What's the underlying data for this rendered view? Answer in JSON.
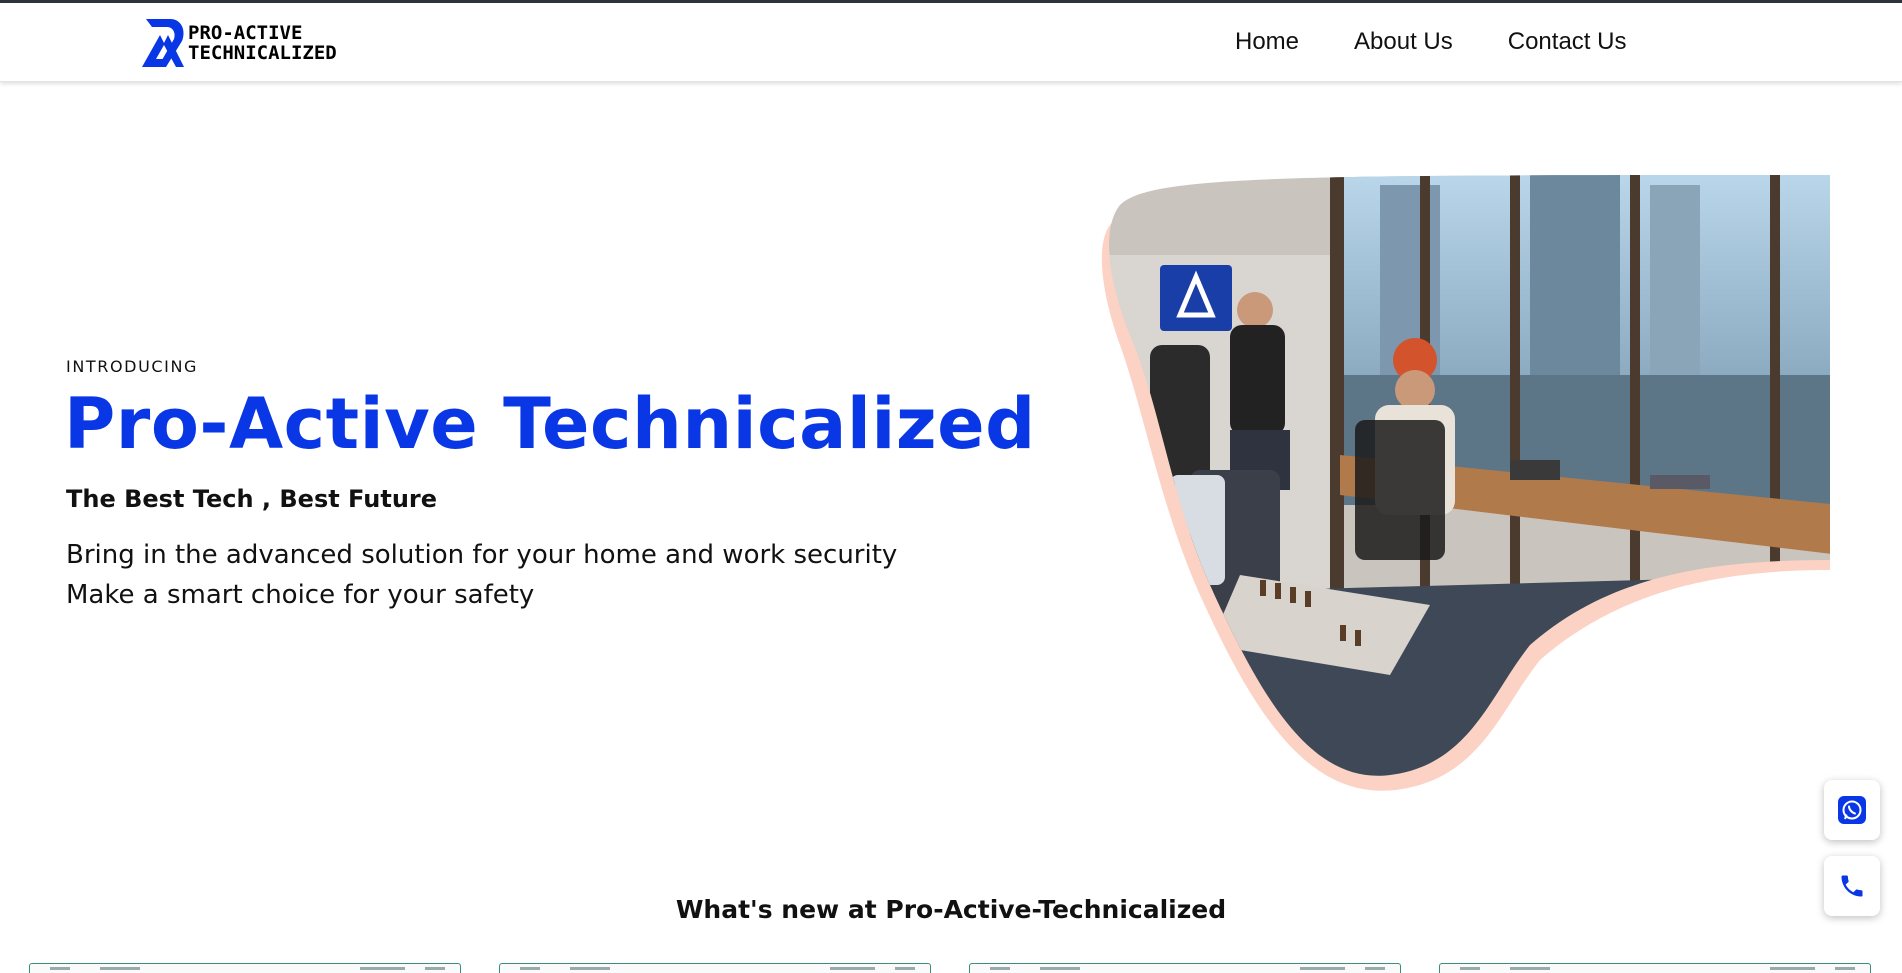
{
  "brand": {
    "line1": "PRO-ACTIVE",
    "line2": "TECHNICALIZED",
    "accent_color": "#0a37e6"
  },
  "nav": {
    "items": [
      {
        "label": "Home"
      },
      {
        "label": "About Us"
      },
      {
        "label": "Contact Us"
      }
    ]
  },
  "hero": {
    "eyebrow": "INTRODUCING",
    "title": "Pro-Active Technicalized",
    "tagline": "The Best Tech , Best Future",
    "description_lines": [
      "Bring in the advanced solution for your home and work security",
      "Make a smart choice for your safety"
    ],
    "image_icon": "office-team-photo",
    "blob_color": "#fbd2c4"
  },
  "floating_actions": {
    "whatsapp_icon": "whatsapp-icon",
    "phone_icon": "phone-icon",
    "icon_color": "#0a37e6"
  },
  "news": {
    "heading": "What's new at Pro-Active-Technicalized",
    "card_count": 4
  }
}
